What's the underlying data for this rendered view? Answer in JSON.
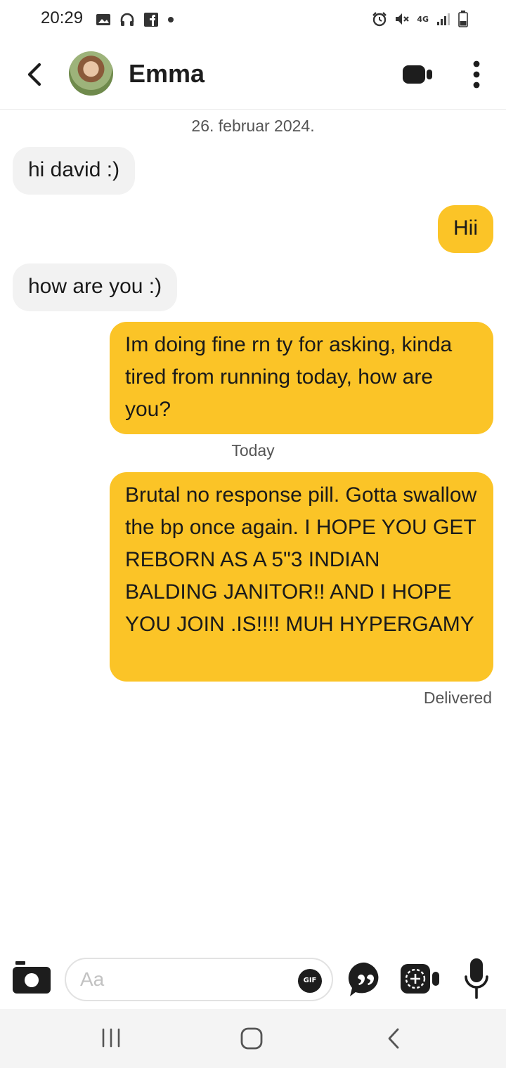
{
  "status_bar": {
    "time": "20:29",
    "network": "4G",
    "left_icons": [
      "gallery-icon",
      "headphones-icon",
      "facebook-icon",
      "dot-icon"
    ],
    "right_icons": [
      "alarm-icon",
      "mute-icon",
      "4g-icon",
      "signal-icon",
      "battery-icon"
    ]
  },
  "header": {
    "contact_name": "Emma",
    "back_icon": "chevron-left-icon",
    "video_icon": "video-camera-icon",
    "more_icon": "more-vertical-icon"
  },
  "messages": {
    "date_first": "26. februar 2024.",
    "date_second": "Today",
    "list": [
      {
        "direction": "in",
        "text": "hi david :)"
      },
      {
        "direction": "out",
        "text": "Hii"
      },
      {
        "direction": "in",
        "text": "how are you :)"
      },
      {
        "direction": "out",
        "text": "Im doing fine rn ty for asking, kinda tired from running today, how are you?"
      },
      {
        "direction": "out",
        "text": "Brutal no response pill. Gotta swallow the bp once again. I HOPE YOU GET REBORN AS A 5\"3 INDIAN BALDING JANITOR!! AND I HOPE YOU JOIN .IS!!!! MUH HYPERGAMY"
      }
    ],
    "status": "Delivered"
  },
  "input_bar": {
    "placeholder": "Aa",
    "gif_label": "GIF",
    "icons": [
      "camera-icon",
      "quote-icon",
      "video-note-icon",
      "microphone-icon"
    ]
  },
  "nav_bar": {
    "icons": [
      "recent-apps-icon",
      "home-icon",
      "back-icon"
    ]
  },
  "colors": {
    "outgoing_bubble": "#fbc427",
    "incoming_bubble": "#f2f2f2",
    "nav_background": "#f4f4f4"
  }
}
